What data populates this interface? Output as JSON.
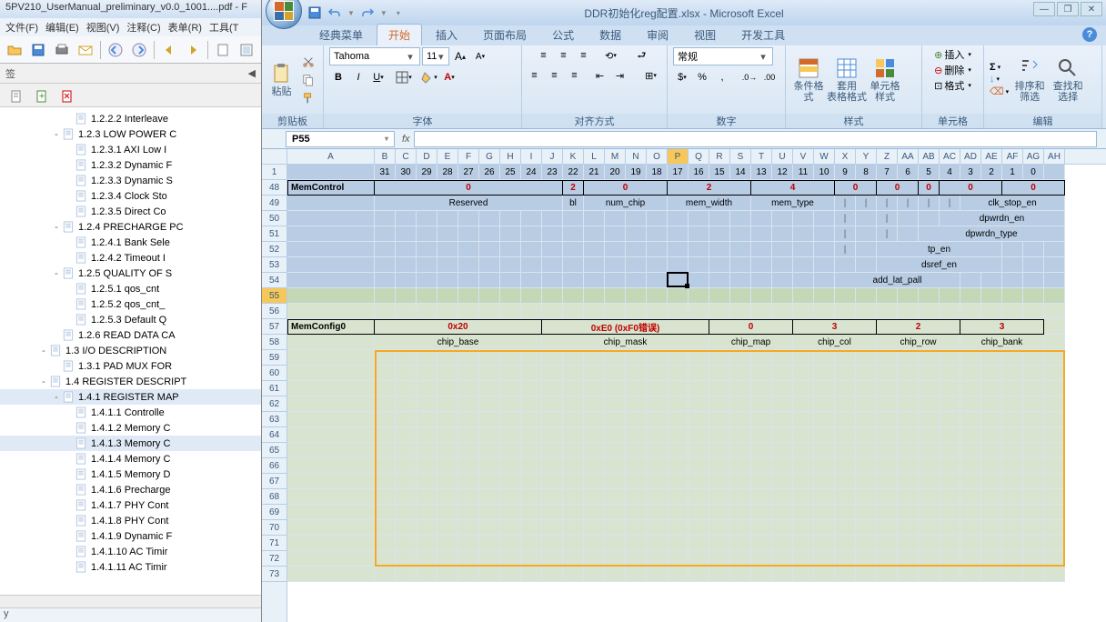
{
  "pdf": {
    "title": "5PV210_UserManual_preliminary_v0.0_1001....pdf - F",
    "menu": [
      "文件(F)",
      "编辑(E)",
      "视图(V)",
      "注释(C)",
      "表单(R)",
      "工具(T"
    ],
    "sidebar_tab": "签",
    "status": "y",
    "outline": [
      {
        "indent": 5,
        "exp": "",
        "text": "1.2.2.2  Interleave"
      },
      {
        "indent": 4,
        "exp": "-",
        "text": "1.2.3  LOW POWER C"
      },
      {
        "indent": 5,
        "exp": "",
        "text": "1.2.3.1  AXI Low I"
      },
      {
        "indent": 5,
        "exp": "",
        "text": "1.2.3.2  Dynamic F"
      },
      {
        "indent": 5,
        "exp": "",
        "text": "1.2.3.3  Dynamic S"
      },
      {
        "indent": 5,
        "exp": "",
        "text": "1.2.3.4  Clock Sto"
      },
      {
        "indent": 5,
        "exp": "",
        "text": "1.2.3.5  Direct Co"
      },
      {
        "indent": 4,
        "exp": "-",
        "text": "1.2.4  PRECHARGE PC"
      },
      {
        "indent": 5,
        "exp": "",
        "text": "1.2.4.1  Bank Sele"
      },
      {
        "indent": 5,
        "exp": "",
        "text": "1.2.4.2  Timeout I"
      },
      {
        "indent": 4,
        "exp": "-",
        "text": "1.2.5  QUALITY OF S"
      },
      {
        "indent": 5,
        "exp": "",
        "text": "1.2.5.1  qos_cnt"
      },
      {
        "indent": 5,
        "exp": "",
        "text": "1.2.5.2  qos_cnt_"
      },
      {
        "indent": 5,
        "exp": "",
        "text": "1.2.5.3  Default Q"
      },
      {
        "indent": 4,
        "exp": "",
        "text": "1.2.6  READ DATA CA"
      },
      {
        "indent": 3,
        "exp": "-",
        "text": "1.3  I/O DESCRIPTION"
      },
      {
        "indent": 4,
        "exp": "",
        "text": "1.3.1  PAD MUX FOR"
      },
      {
        "indent": 3,
        "exp": "-",
        "text": "1.4  REGISTER DESCRIPT"
      },
      {
        "indent": 4,
        "exp": "-",
        "text": "1.4.1  REGISTER MAP",
        "sel": true
      },
      {
        "indent": 5,
        "exp": "",
        "text": "1.4.1.1  Controlle"
      },
      {
        "indent": 5,
        "exp": "",
        "text": "1.4.1.2  Memory C"
      },
      {
        "indent": 5,
        "exp": "",
        "text": "1.4.1.3  Memory C",
        "sel": true
      },
      {
        "indent": 5,
        "exp": "",
        "text": "1.4.1.4  Memory C"
      },
      {
        "indent": 5,
        "exp": "",
        "text": "1.4.1.5  Memory D"
      },
      {
        "indent": 5,
        "exp": "",
        "text": "1.4.1.6  Precharge"
      },
      {
        "indent": 5,
        "exp": "",
        "text": "1.4.1.7  PHY Cont"
      },
      {
        "indent": 5,
        "exp": "",
        "text": "1.4.1.8  PHY Cont"
      },
      {
        "indent": 5,
        "exp": "",
        "text": "1.4.1.9  Dynamic F"
      },
      {
        "indent": 5,
        "exp": "",
        "text": "1.4.1.10  AC Timir"
      },
      {
        "indent": 5,
        "exp": "",
        "text": "1.4.1.11  AC Timir"
      }
    ]
  },
  "excel": {
    "title": "DDR初始化reg配置.xlsx - Microsoft Excel",
    "tabs": [
      "经典菜单",
      "开始",
      "插入",
      "页面布局",
      "公式",
      "数据",
      "审阅",
      "视图",
      "开发工具"
    ],
    "active_tab": 1,
    "font_name": "Tahoma",
    "font_size": "11",
    "num_format": "常规",
    "group_labels": {
      "clipboard": "剪贴板",
      "font": "字体",
      "align": "对齐方式",
      "number": "数字",
      "styles": "样式",
      "cells": "单元格",
      "editing": "编辑"
    },
    "btn_labels": {
      "paste": "粘贴",
      "cond": "条件格式",
      "table": "套用\n表格格式",
      "cellstyle": "单元格\n样式",
      "insert": "插入",
      "delete": "删除",
      "format": "格式",
      "sort": "排序和\n筛选",
      "find": "查找和\n选择"
    },
    "namebox": "P55",
    "cols": [
      "A",
      "B",
      "C",
      "D",
      "E",
      "F",
      "G",
      "H",
      "I",
      "J",
      "K",
      "L",
      "M",
      "N",
      "O",
      "P",
      "Q",
      "R",
      "S",
      "T",
      "U",
      "V",
      "W",
      "X",
      "Y",
      "Z",
      "AA",
      "AB",
      "AC",
      "AD",
      "AE",
      "AF",
      "AG",
      "AH"
    ],
    "row_nums": [
      1,
      48,
      49,
      50,
      51,
      52,
      53,
      54,
      55,
      56,
      57,
      58,
      59,
      60,
      61,
      62,
      63,
      64,
      65,
      66,
      67,
      68,
      69,
      70,
      71,
      72,
      73
    ],
    "bit_row": [
      "",
      "31",
      "30",
      "29",
      "28",
      "27",
      "26",
      "25",
      "24",
      "23",
      "22",
      "21",
      "20",
      "19",
      "18",
      "17",
      "16",
      "15",
      "14",
      "13",
      "12",
      "11",
      "10",
      "9",
      "8",
      "7",
      "6",
      "5",
      "4",
      "3",
      "2",
      "1",
      "0",
      ""
    ],
    "memcontrol": {
      "label": "MemControl",
      "groups": [
        {
          "span": 9,
          "val": "0"
        },
        {
          "span": 1,
          "val": "2"
        },
        {
          "span": 4,
          "val": "0"
        },
        {
          "span": 4,
          "val": "2"
        },
        {
          "span": 4,
          "val": "4"
        },
        {
          "span": 2,
          "val": "0"
        },
        {
          "span": 2,
          "val": "0"
        },
        {
          "span": 1,
          "val": "0"
        },
        {
          "span": 3,
          "val": "0"
        },
        {
          "span": 3,
          "val": "0"
        }
      ],
      "fields": [
        {
          "start": 1,
          "span": 9,
          "text": "Reserved",
          "pipe_after": true
        },
        {
          "start": 10,
          "span": 1,
          "text": "bl",
          "pipe_after": true
        },
        {
          "start": 11,
          "span": 4,
          "text": "num_chip",
          "pipe_after": true
        },
        {
          "start": 15,
          "span": 4,
          "text": "mem_width",
          "pipe_after": true
        },
        {
          "start": 19,
          "span": 4,
          "text": "mem_type"
        },
        {
          "start": 29,
          "span": 5,
          "text": "clk_stop_en"
        }
      ],
      "extras": [
        {
          "row": 50,
          "start": 28,
          "span": 6,
          "text": "dpwrdn_en",
          "pipes": [
            23,
            25
          ]
        },
        {
          "row": 51,
          "start": 27,
          "span": 7,
          "text": "dpwrdn_type",
          "pipes": [
            23,
            25
          ]
        },
        {
          "row": 52,
          "start": 25,
          "span": 6,
          "text": "tp_en",
          "pipes": [
            23
          ]
        },
        {
          "row": 53,
          "start": 25,
          "span": 6,
          "text": "dsref_en",
          "pipes": []
        },
        {
          "row": 54,
          "start": 23,
          "span": 6,
          "text": "add_lat_pall",
          "pipes": []
        }
      ]
    },
    "memconfig": {
      "label": "MemConfig0",
      "groups": [
        {
          "span": 8,
          "val": "0x20"
        },
        {
          "span": 8,
          "val": "0xE0  (0xF0错误)"
        },
        {
          "span": 4,
          "val": "0"
        },
        {
          "span": 4,
          "val": "3"
        },
        {
          "span": 4,
          "val": "2"
        },
        {
          "span": 4,
          "val": "3"
        }
      ],
      "fields": [
        {
          "start": 1,
          "span": 8,
          "text": "chip_base"
        },
        {
          "start": 9,
          "span": 8,
          "text": "chip_mask"
        },
        {
          "start": 17,
          "span": 4,
          "text": "chip_map"
        },
        {
          "start": 21,
          "span": 4,
          "text": "chip_col"
        },
        {
          "start": 25,
          "span": 4,
          "text": "chip_row"
        },
        {
          "start": 29,
          "span": 4,
          "text": "chip_bank"
        }
      ]
    }
  }
}
